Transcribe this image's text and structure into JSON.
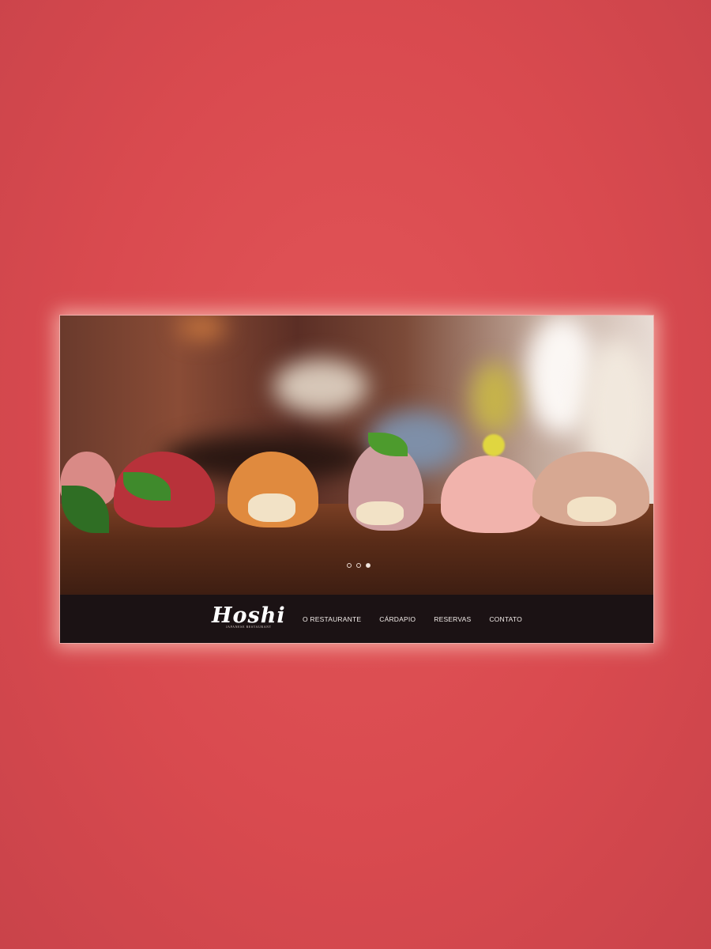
{
  "brand": {
    "name": "Hoshi",
    "tagline": "JAPANESE RESTAURANT"
  },
  "nav": {
    "items": [
      {
        "label": "O RESTAURANTE"
      },
      {
        "label": "CÁRDAPIO"
      },
      {
        "label": "RESERVAS"
      },
      {
        "label": "CONTATO"
      }
    ]
  },
  "slider": {
    "slide_count": 3,
    "active_index": 2
  },
  "colors": {
    "background": "#d94a4f",
    "navbar": "#1b1214",
    "nav_text": "#f2ece9"
  }
}
